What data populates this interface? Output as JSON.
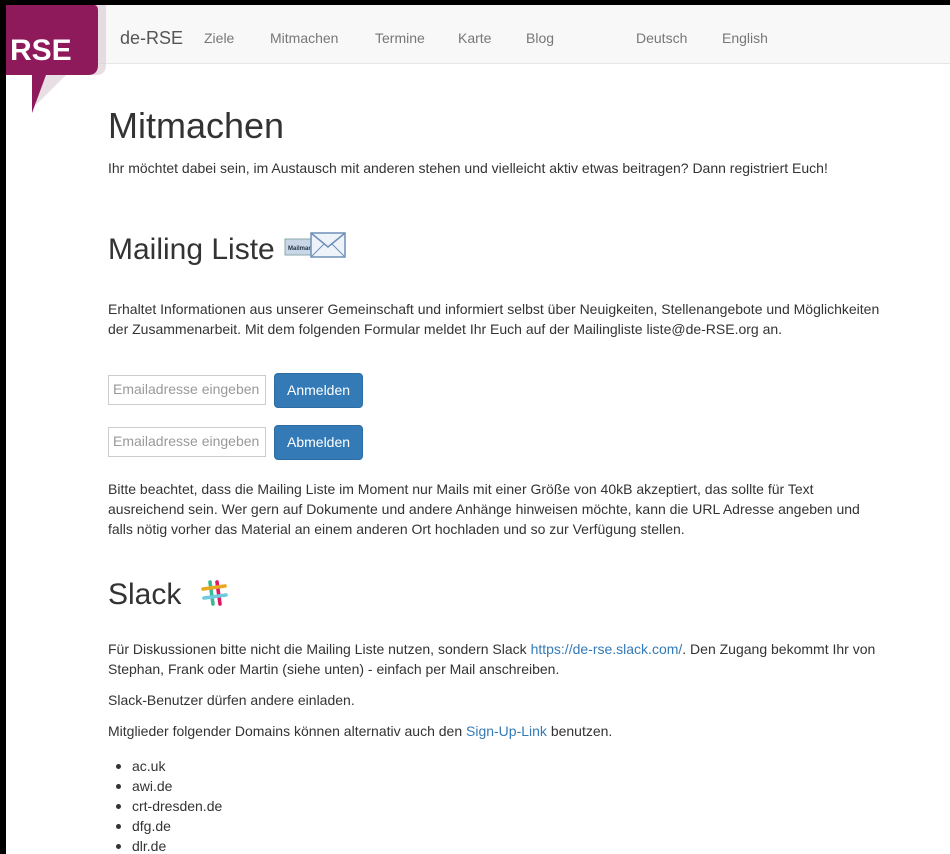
{
  "logo": {
    "text": "RSE"
  },
  "nav": {
    "brand": "de-RSE",
    "items": [
      "Ziele",
      "Mitmachen",
      "Termine",
      "Karte",
      "Blog"
    ],
    "languages": [
      "Deutsch",
      "English"
    ]
  },
  "page": {
    "title": "Mitmachen",
    "intro": "Ihr möchtet dabei sein, im Austausch mit anderen stehen und vielleicht aktiv etwas beitragen? Dann registriert Euch!",
    "mailing": {
      "heading": "Mailing Liste",
      "icon_text": "Mailman",
      "description": "Erhaltet Informationen aus unserer Gemeinschaft und informiert selbst über Neuigkeiten, Stellenangebote und Möglichkeiten der Zusammenarbeit. Mit dem folgenden Formular meldet Ihr Euch auf der Mailingliste liste@de-RSE.org an.",
      "subscribe_placeholder": "Emailadresse eingeben",
      "subscribe_button": "Anmelden",
      "unsubscribe_placeholder": "Emailadresse eingeben",
      "unsubscribe_button": "Abmelden",
      "note": "Bitte beachtet, dass die Mailing Liste im Moment nur Mails mit einer Größe von 40kB akzeptiert, das sollte für Text ausreichend sein. Wer gern auf Dokumente und andere Anhänge hinweisen möchte, kann die URL Adresse angeben und falls nötig vorher das Material an einem anderen Ort hochladen und so zur Verfügung stellen."
    },
    "slack": {
      "heading": "Slack",
      "p1_before": "Für Diskussionen bitte nicht die Mailing Liste nutzen, sondern Slack ",
      "p1_link": "https://de-rse.slack.com/",
      "p1_after": ". Den Zugang bekommt Ihr von Stephan, Frank oder Martin (siehe unten) - einfach per Mail anschreiben.",
      "p2": "Slack-Benutzer dürfen andere einladen.",
      "p3_before": "Mitglieder folgender Domains können alternativ auch den ",
      "p3_link": "Sign-Up-Link",
      "p3_after": " benutzen.",
      "domains": [
        "ac.uk",
        "awi.de",
        "crt-dresden.de",
        "dfg.de",
        "dlr.de"
      ]
    }
  },
  "colors": {
    "logo_magenta": "#8e1a5c",
    "link_blue": "#337ab7",
    "button_blue": "#337ab7"
  }
}
